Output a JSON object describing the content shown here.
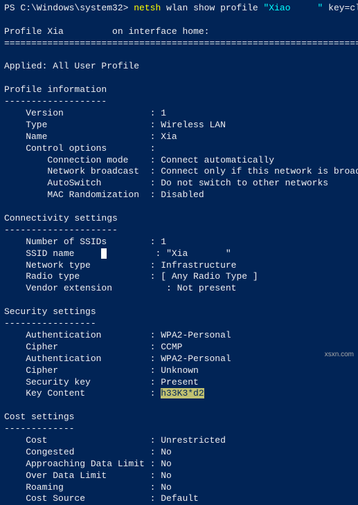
{
  "prompt": {
    "ps": "PS C:\\Windows\\system32>",
    "cmd": "netsh",
    "args": " wlan show profile ",
    "quoted": "\"Xiao",
    "quoted_censored": "     ",
    "quoted_end": "\"",
    "tail": " key=clear"
  },
  "header": {
    "text": "Profile Xia",
    "text2": " on interface home:"
  },
  "applied": "Applied: All User Profile",
  "profile_info": {
    "title": "Profile information",
    "underline": "-------------------",
    "version_label": "    Version                : ",
    "version_value": "1",
    "type_label": "    Type                   : ",
    "type_value": "Wireless LAN",
    "name_label": "    Name                   : ",
    "name_value": "Xia",
    "control_label": "    Control options        :",
    "conn_mode_label": "        Connection mode    : ",
    "conn_mode_value": "Connect automatically",
    "broadcast_label": "        Network broadcast  : ",
    "broadcast_value": "Connect only if this network is broadcasting",
    "autoswitch_label": "        AutoSwitch         : ",
    "autoswitch_value": "Do not switch to other networks",
    "macrand_label": "        MAC Randomization  : ",
    "macrand_value": "Disabled"
  },
  "connectivity": {
    "title": "Connectivity settings",
    "underline": "---------------------",
    "num_ssid_label": "    Number of SSIDs        : ",
    "num_ssid_value": "1",
    "ssid_name_label": "    SSID name     ",
    "ssid_name_label2": "         : ",
    "ssid_name_value": "\"Xia",
    "ssid_name_value2": "\"",
    "nettype_label": "    Network type           : ",
    "nettype_value": "Infrastructure",
    "radio_label": "    Radio type             : ",
    "radio_value": "[ Any Radio Type ]",
    "vendor_label": "    Vendor extension          : ",
    "vendor_value": "Not present"
  },
  "security": {
    "title": "Security settings",
    "underline": "-----------------",
    "auth1_label": "    Authentication         : ",
    "auth1_value": "WPA2-Personal",
    "cipher1_label": "    Cipher                 : ",
    "cipher1_value": "CCMP",
    "auth2_label": "    Authentication         : ",
    "auth2_value": "WPA2-Personal",
    "cipher2_label": "    Cipher                 : ",
    "cipher2_value": "Unknown",
    "seckey_label": "    Security key           : ",
    "seckey_value": "Present",
    "keycontent_label": "    Key Content            : ",
    "keycontent_value": "h33K3*d2"
  },
  "cost": {
    "title": "Cost settings",
    "underline": "-------------",
    "cost_label": "    Cost                   : ",
    "cost_value": "Unrestricted",
    "congested_label": "    Congested              : ",
    "congested_value": "No",
    "approach_label": "    Approaching Data Limit : ",
    "approach_value": "No",
    "over_label": "    Over Data Limit        : ",
    "over_value": "No",
    "roaming_label": "    Roaming                : ",
    "roaming_value": "No",
    "source_label": "    Cost Source            : ",
    "source_value": "Default"
  },
  "watermark": "xsxn.com"
}
